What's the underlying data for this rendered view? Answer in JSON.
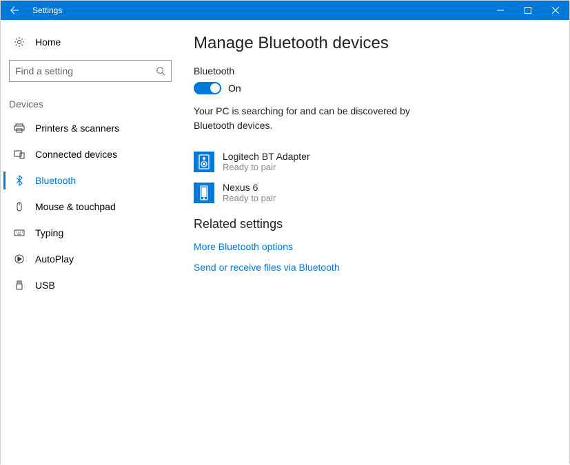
{
  "titlebar": {
    "title": "Settings"
  },
  "sidebar": {
    "home_label": "Home",
    "search_placeholder": "Find a setting",
    "section_label": "Devices",
    "items": [
      {
        "label": "Printers & scanners"
      },
      {
        "label": "Connected devices"
      },
      {
        "label": "Bluetooth"
      },
      {
        "label": "Mouse & touchpad"
      },
      {
        "label": "Typing"
      },
      {
        "label": "AutoPlay"
      },
      {
        "label": "USB"
      }
    ]
  },
  "main": {
    "title": "Manage Bluetooth devices",
    "toggle_label": "Bluetooth",
    "toggle_state": "On",
    "status_text": "Your PC is searching for and can be discovered by Bluetooth devices.",
    "devices": [
      {
        "name": "Logitech BT Adapter",
        "status": "Ready to pair"
      },
      {
        "name": "Nexus 6",
        "status": "Ready to pair"
      }
    ],
    "related_heading": "Related settings",
    "links": [
      {
        "label": "More Bluetooth options"
      },
      {
        "label": "Send or receive files via Bluetooth"
      }
    ]
  }
}
